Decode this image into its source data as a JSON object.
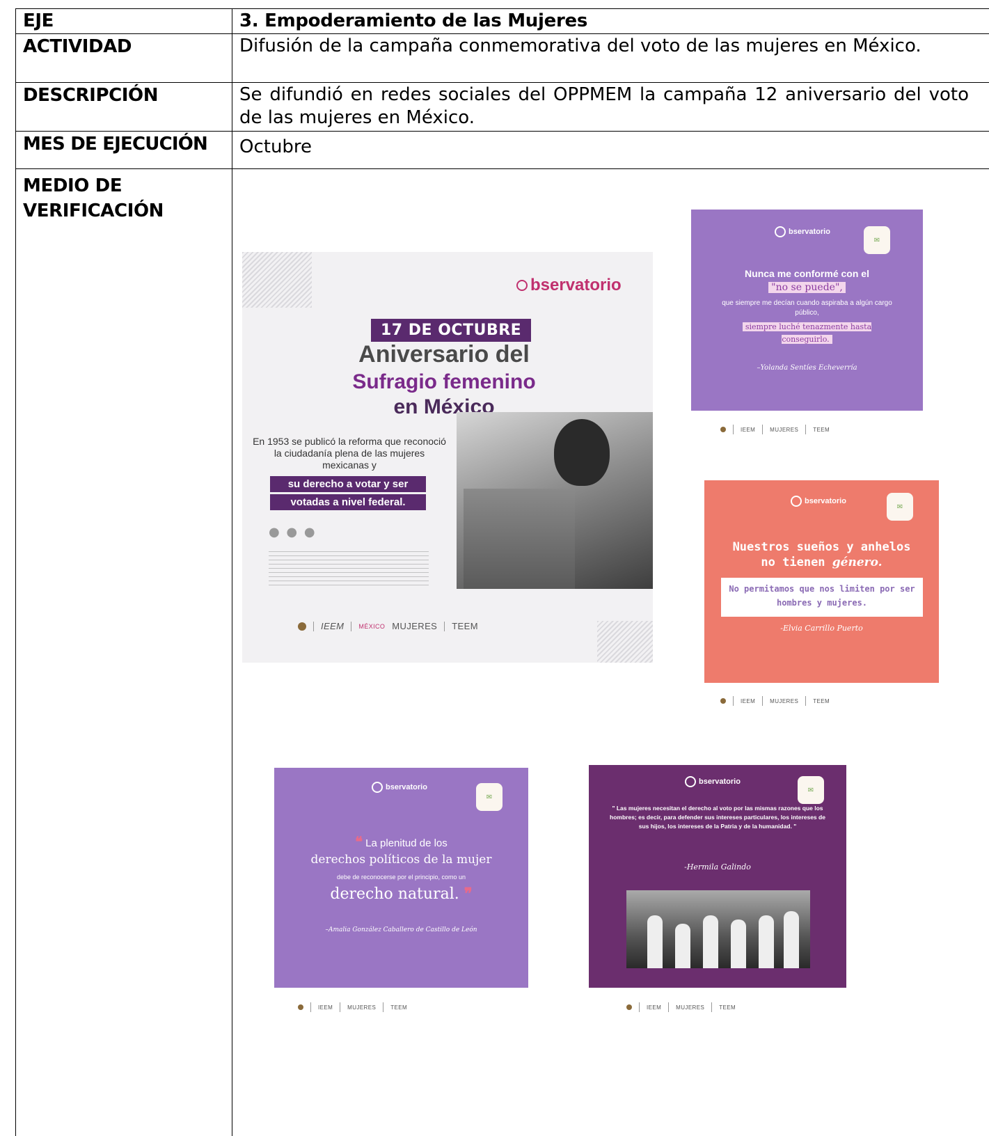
{
  "table": {
    "rows": [
      {
        "label": "EJE",
        "value": "3. Empoderamiento de las Mujeres"
      },
      {
        "label": "ACTIVIDAD",
        "value": "Difusión de la campaña conmemorativa del voto de las mujeres en México."
      },
      {
        "label": "DESCRIPCIÓN",
        "value": "Se difundió en redes sociales del OPPMEM la campaña 12 aniversario del voto de las mujeres en México."
      },
      {
        "label": "MES DE EJECUCIÓN",
        "value": "Octubre"
      },
      {
        "label_line1": "MEDIO DE",
        "label_line2": "VERIFICACIÓN"
      }
    ]
  },
  "posts": {
    "logos": {
      "mujeres": "MUJERES",
      "teem": "TEEM",
      "ieem": "IEEM",
      "mexico": "MÉXICO"
    },
    "observatorio": "bservatorio",
    "main": {
      "date": "17 DE OCTUBRE",
      "title_1": "Aniversario del",
      "title_2": "Sufragio femenino",
      "title_3": "en México",
      "body": "En 1953 se publicó la reforma que reconoció la ciudadanía plena de las mujeres mexicanas y",
      "band_1": "su derecho a votar y ser",
      "band_2": "votadas a nivel federal.",
      "ellipsis": "● ● ●"
    },
    "quote_1": {
      "line_1": "Nunca me conformé con el",
      "highlight": "\"no se puede\",",
      "line_2": "que siempre me decían cuando aspiraba a algún cargo público,",
      "line_3": "siempre luché tenazmente hasta conseguirlo.",
      "author": "–Yolanda Sentíes Echeverría"
    },
    "quote_2": {
      "line_1": "Nuestros sueños y anhelos",
      "line_2a": "no tienen ",
      "line_2b": "género.",
      "box": "No permitamos que nos limiten por ser hombres y mujeres.",
      "author": "-Elvia Carrillo Puerto"
    },
    "quote_3": {
      "line_1": "La plenitud de los",
      "line_2": "derechos políticos de la mujer",
      "line_3": "debe de reconocerse por el principio, como un",
      "line_4": "derecho natural.",
      "author": "–Amalia González Caballero de Castillo de León"
    },
    "quote_4": {
      "text": "\" Las mujeres necesitan el derecho al voto por las mismas razones que los hombres; es decir, para defender sus intereses particulares, los intereses de sus hijos, los intereses de la Patria y de la humanidad. \"",
      "author": "-Hermila Galindo"
    }
  }
}
